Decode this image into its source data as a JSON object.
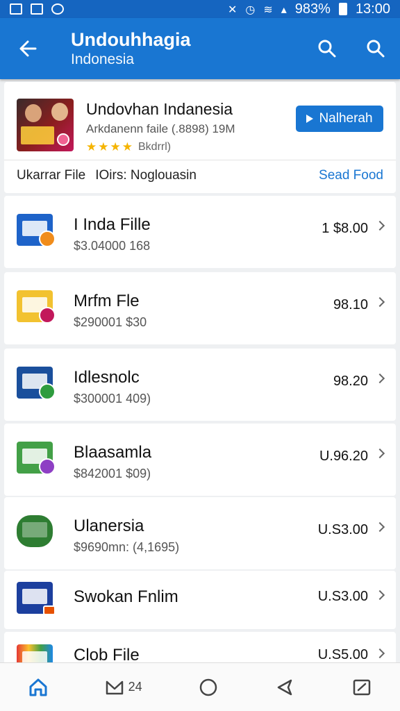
{
  "status_bar": {
    "icons_left": [
      "image-icon",
      "photo-icon",
      "clock-icon"
    ],
    "icons_right": [
      "mute-icon",
      "alarm-icon",
      "wifi-icon",
      "signal-icon"
    ],
    "battery": "983%",
    "time": "13:00"
  },
  "app_bar": {
    "title": "Undouhhagia",
    "subtitle": "Indonesia",
    "icons": [
      "back-arrow-icon",
      "search-icon",
      "search-icon"
    ]
  },
  "header": {
    "title": "Undovhan Indanesia",
    "meta": "Arkdanenn faile (.8898) 19M",
    "rating_stars": 4,
    "rating_text": "Bkdrrl)",
    "install_label": "Nalherah",
    "filter_label": "Ukarrar File",
    "filter_key": "IOirs:",
    "filter_value": "Noglouasin",
    "link_label": "Sead Food"
  },
  "items": [
    {
      "name": "I Inda Fille",
      "sub": "$3.04000 168",
      "price": "1 $8.00",
      "icon_color": "#1e63c9",
      "badge_color": "#f08c1b"
    },
    {
      "name": "Mrfm Fle",
      "sub": "$290001 $30",
      "price": "98.10",
      "icon_color": "#f2c230",
      "badge_color": "#c2185b"
    },
    {
      "name": "Idlesnolc",
      "sub": "$300001 409)",
      "price": "98.20",
      "icon_color": "#1a4f9c",
      "badge_color": "#2e9c3e"
    },
    {
      "name": "Blaasamla",
      "sub": "$842001 $09)",
      "price": "U.96.20",
      "icon_color": "#43a047",
      "badge_color": "#8e3fc4"
    },
    {
      "name": "Ulanersia",
      "sub": "$9690mn: (4,1695)",
      "price": "U.S3.00",
      "icon_color": "#2e7d32",
      "badge_color": "#2e7d32"
    },
    {
      "name": "Swokan Fnlim",
      "sub": "",
      "price": "U.S3.00",
      "icon_color": "#1c3f9e",
      "badge_color": "#e65100"
    },
    {
      "name": "Clob File",
      "sub": "",
      "price": "U.S5.00",
      "icon_color": "#e53935",
      "badge_color": "#fbc02d"
    }
  ],
  "bottom_nav": {
    "items": [
      "home-icon",
      "mail-icon",
      "circle-icon",
      "back-triangle-icon",
      "edit-icon"
    ],
    "mail_count": "24"
  }
}
